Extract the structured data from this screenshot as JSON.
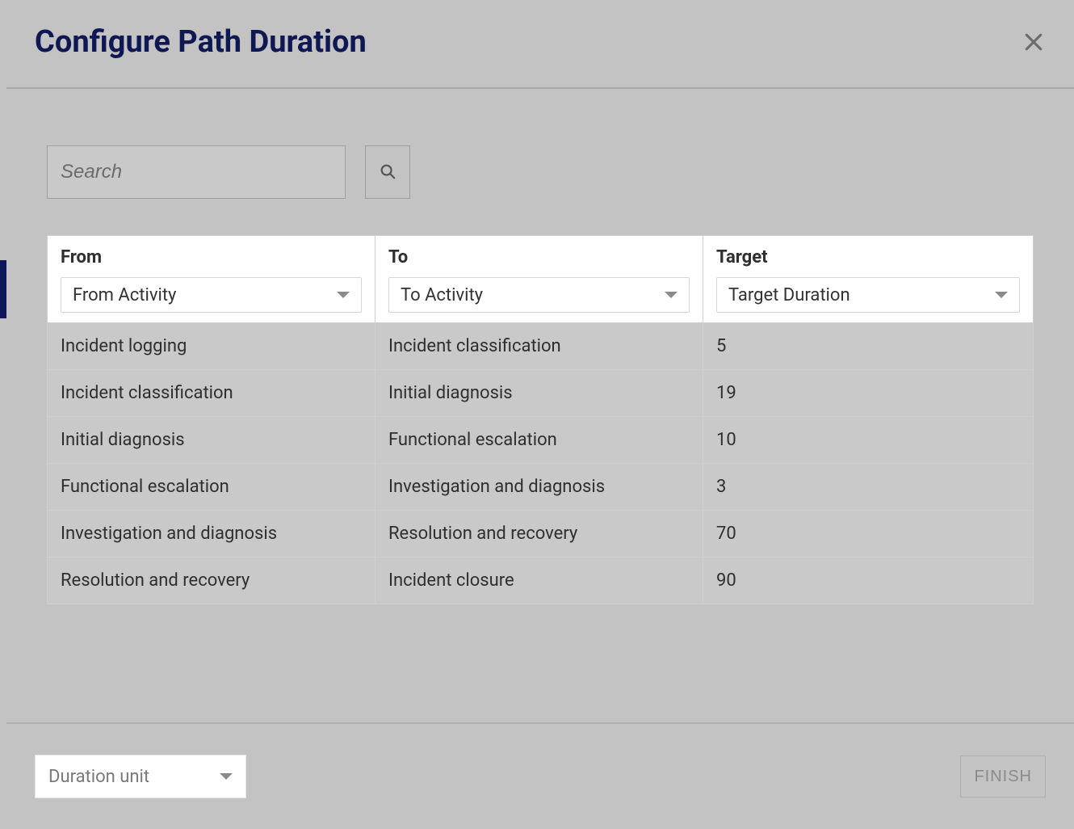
{
  "header": {
    "title": "Configure Path Duration",
    "close_icon": "close"
  },
  "search": {
    "placeholder": "Search",
    "button_icon": "search"
  },
  "table": {
    "columns": {
      "from": {
        "label": "From",
        "dropdown": "From Activity"
      },
      "to": {
        "label": "To",
        "dropdown": "To Activity"
      },
      "target": {
        "label": "Target",
        "dropdown": "Target Duration"
      }
    },
    "rows": [
      {
        "from": "Incident logging",
        "to": "Incident classification",
        "target": "5"
      },
      {
        "from": "Incident classification",
        "to": "Initial diagnosis",
        "target": "19"
      },
      {
        "from": "Initial diagnosis",
        "to": "Functional escalation",
        "target": "10"
      },
      {
        "from": "Functional escalation",
        "to": "Investigation and diagnosis",
        "target": "3"
      },
      {
        "from": "Investigation and diagnosis",
        "to": "Resolution and recovery",
        "target": "70"
      },
      {
        "from": "Resolution and recovery",
        "to": "Incident closure",
        "target": "90"
      }
    ]
  },
  "footer": {
    "duration_unit_label": "Duration unit",
    "finish_label": "FINISH"
  }
}
